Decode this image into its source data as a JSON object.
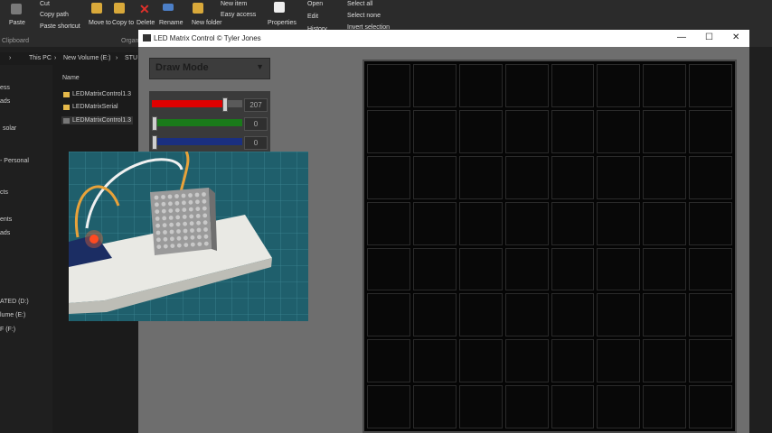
{
  "ribbon": {
    "cut": "Cut",
    "copy_path": "Copy path",
    "paste_shortcut": "Paste shortcut",
    "paste": "Paste",
    "clipboard": "Clipboard",
    "move_to": "Move to",
    "copy_to": "Copy to",
    "organize": "Organ",
    "delete": "Delete",
    "rename": "Rename",
    "new_folder": "New folder",
    "new_item": "New item",
    "easy_access": "Easy access",
    "properties": "Properties",
    "open": "Open",
    "edit": "Edit",
    "history": "History",
    "select_all": "Select all",
    "select_none": "Select none",
    "invert_selection": "Invert selection"
  },
  "address": {
    "this_pc": "This PC",
    "volume": "New Volume (E:)",
    "folder": "STU"
  },
  "nav": [
    "ess",
    "ads",
    "solar",
    "- Personal",
    "cts",
    "ents",
    "ads",
    "ATED (D:)",
    "lume (E:)",
    "F (F:)"
  ],
  "files": {
    "header": "Name",
    "items": [
      "LEDMatrixControl1.3",
      "LEDMatrixSerial",
      "LEDMatrixControl1.3"
    ]
  },
  "app": {
    "title": "LED Matrix Control © Tyler Jones",
    "minimize": "—",
    "maximize": "☐",
    "close": "✕",
    "mode": "Draw Mode",
    "red": 207,
    "green": 0,
    "blue": 0
  },
  "colors": {
    "red": "#e00000",
    "green": "#1a7a1a",
    "blue": "#1a2f80"
  }
}
